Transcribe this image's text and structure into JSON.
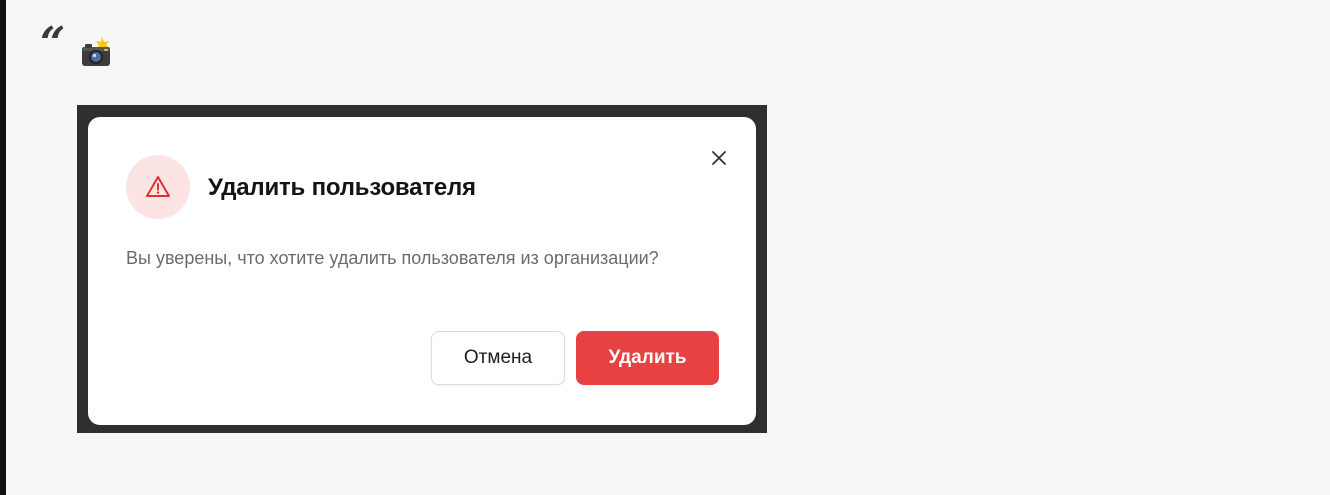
{
  "header": {
    "quote_glyph": "“",
    "camera_icon": "camera-flash-icon"
  },
  "dialog": {
    "title": "Удалить пользователя",
    "message": "Вы уверены, что хотите удалить пользователя из организации?",
    "warning_icon": "warning-triangle-icon",
    "close_icon": "close-icon",
    "cancel_label": "Отмена",
    "delete_label": "Удалить"
  },
  "colors": {
    "page_background": "#f7f7f7",
    "frame_background": "#2f2f2f",
    "danger": "#e84141",
    "danger_soft": "#fde4e4",
    "title_text": "#141414",
    "body_text": "#6b6b6b"
  }
}
